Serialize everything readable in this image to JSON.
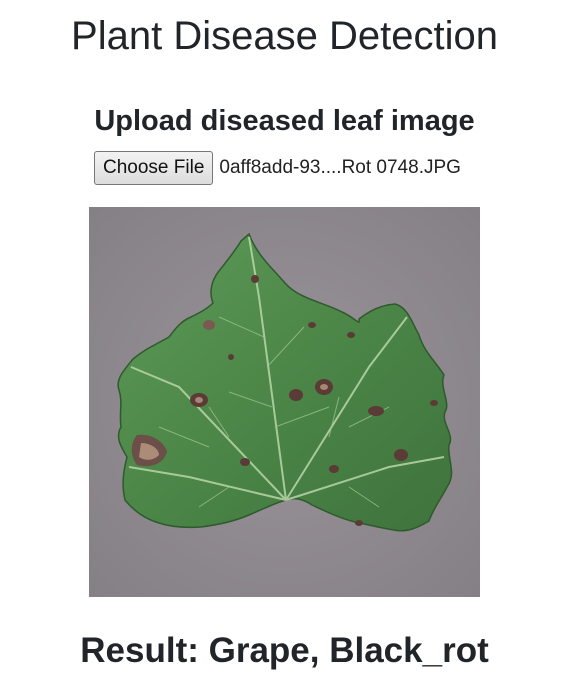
{
  "page": {
    "title": "Plant Disease Detection"
  },
  "upload": {
    "heading": "Upload diseased leaf image",
    "button_label": "Choose File",
    "selected_file": "0aff8add-93....Rot 0748.JPG"
  },
  "preview": {
    "icon": "leaf-photo",
    "background_color": "#8f8a8f",
    "leaf_color": "#4f8a4a",
    "lesion_color": "#5a3b35"
  },
  "result": {
    "text": "Result: Grape, Black_rot"
  }
}
